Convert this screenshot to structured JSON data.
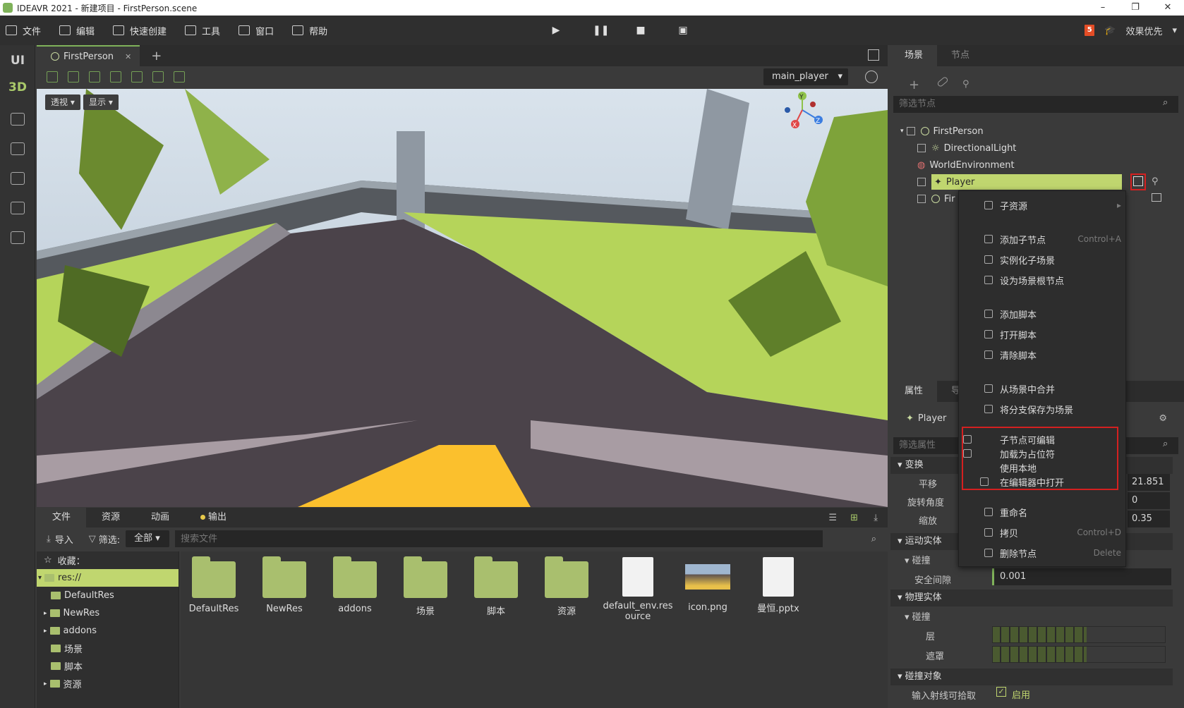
{
  "window": {
    "title": "IDEAVR 2021 - 新建项目 - FirstPerson.scene",
    "min": "–",
    "max": "❐",
    "close": "✕"
  },
  "menu": {
    "file": "文件",
    "edit": "编辑",
    "quick": "快速创建",
    "tools": "工具",
    "window": "窗口",
    "help": "帮助",
    "quality": "效果优先"
  },
  "left_tools": {
    "ui": "UI",
    "threed": "3D"
  },
  "viewport": {
    "tab": "FirstPerson",
    "tab_close": "✕",
    "add_tab": "+",
    "camera": "main_player",
    "perspective": "透视",
    "display": "显示",
    "gizmo": {
      "x": "X",
      "y": "Y",
      "z": "Z"
    }
  },
  "bottom": {
    "tabs": [
      "文件",
      "资源",
      "动画",
      "输出"
    ],
    "import": "导入",
    "filter_label": "筛选:",
    "filter_value": "全部",
    "search_placeholder": "搜索文件",
    "favorites": "收藏：",
    "tree": [
      "res://",
      "DefaultRes",
      "NewRes",
      "addons",
      "场景",
      "脚本",
      "资源"
    ],
    "files": [
      "DefaultRes",
      "NewRes",
      "addons",
      "场景",
      "脚本",
      "资源",
      "default_env.resource",
      "icon.png",
      "曼恒.pptx"
    ]
  },
  "scene": {
    "tabs": [
      "场景",
      "节点"
    ],
    "filter_placeholder": "筛选节点",
    "nodes": [
      "FirstPerson",
      "DirectionalLight",
      "WorldEnvironment",
      "Player",
      "Fir"
    ]
  },
  "inspector": {
    "tabs": [
      "属性",
      "导"
    ],
    "node": "Player",
    "filter_placeholder": "筛选属性",
    "sections": [
      "变换",
      "运动实体",
      "碰撞",
      "物理实体",
      "碰撞",
      "碰撞对象"
    ],
    "props": {
      "translate": "平移",
      "rotate": "旋转角度",
      "scale": "缩放",
      "margin": "安全间隙",
      "layer": "层",
      "mask": "遮罩",
      "ray": "输入射线可拾取",
      "enable": "启用"
    },
    "values": {
      "translate": "21.851",
      "rotate": "0",
      "scale": "0.35",
      "margin": "0.001"
    }
  },
  "context_menu": {
    "items": [
      {
        "label": "子资源",
        "shortcut": ""
      },
      {
        "label": "添加子节点",
        "shortcut": "Control+A"
      },
      {
        "label": "实例化子场景",
        "shortcut": ""
      },
      {
        "label": "设为场景根节点",
        "shortcut": ""
      },
      {
        "label": "添加脚本",
        "shortcut": ""
      },
      {
        "label": "打开脚本",
        "shortcut": ""
      },
      {
        "label": "清除脚本",
        "shortcut": ""
      },
      {
        "label": "从场景中合并",
        "shortcut": ""
      },
      {
        "label": "将分支保存为场景",
        "shortcut": ""
      },
      {
        "label": "子节点可编辑",
        "shortcut": ""
      },
      {
        "label": "加载为占位符",
        "shortcut": ""
      },
      {
        "label": "使用本地",
        "shortcut": ""
      },
      {
        "label": "在编辑器中打开",
        "shortcut": ""
      },
      {
        "label": "重命名",
        "shortcut": ""
      },
      {
        "label": "拷贝",
        "shortcut": "Control+D"
      },
      {
        "label": "删除节点",
        "shortcut": "Delete"
      }
    ]
  },
  "colors": {
    "accent": "#7fb25a",
    "highlight": "#c0d66f",
    "red": "#d42020",
    "panel": "#3a3a3a"
  }
}
